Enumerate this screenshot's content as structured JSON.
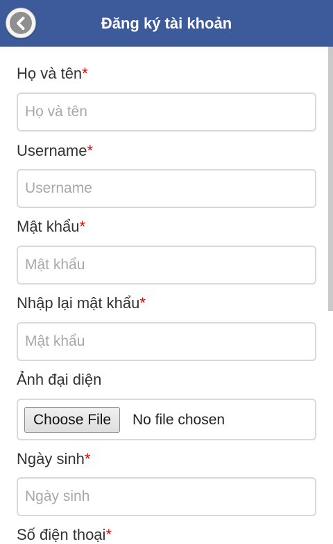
{
  "header": {
    "title": "Đăng ký tài khoản",
    "back_icon": "chevron-left-icon"
  },
  "form": {
    "fullname": {
      "label": "Họ và tên",
      "required_mark": "*",
      "placeholder": "Họ và tên",
      "value": ""
    },
    "username": {
      "label": "Username",
      "required_mark": "*",
      "placeholder": "Username",
      "value": ""
    },
    "password": {
      "label": "Mật khẩu",
      "required_mark": "*",
      "placeholder": "Mật khẩu",
      "value": ""
    },
    "confirm_password": {
      "label": "Nhập lại mật khẩu",
      "required_mark": "*",
      "placeholder": "Mật khẩu",
      "value": ""
    },
    "avatar": {
      "label": "Ảnh đại diện",
      "button_label": "Choose File",
      "status": "No file chosen"
    },
    "birthday": {
      "label": "Ngày sinh",
      "required_mark": "*",
      "placeholder": "Ngày sinh",
      "value": ""
    },
    "phone": {
      "label": "Số điện thoại",
      "required_mark": "*"
    }
  },
  "colors": {
    "header_bg": "#3d5b9b",
    "required": "#e00000"
  }
}
